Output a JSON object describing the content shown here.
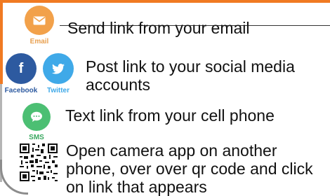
{
  "colors": {
    "accent_border": "#f07a22",
    "email": "#f2a14a",
    "facebook": "#2d5aa0",
    "twitter": "#3fa9e8",
    "sms": "#4cbf73"
  },
  "share_options": {
    "email": {
      "icon": "envelope-icon",
      "label": "Email",
      "text": "Send link from your email"
    },
    "social": {
      "facebook_icon": "facebook-icon",
      "facebook_label": "Facebook",
      "twitter_icon": "twitter-icon",
      "twitter_label": "Twitter",
      "text_line1": "Post link to your social media",
      "text_line2": "accounts"
    },
    "sms": {
      "icon": "chat-bubble-icon",
      "label": "SMS",
      "text": "Text link from your cell phone"
    },
    "qr": {
      "icon": "qr-code-icon",
      "text_line1": "Open camera app on another",
      "text_line2": "phone, over over qr code and click",
      "text_line3": "on link that appears"
    }
  }
}
